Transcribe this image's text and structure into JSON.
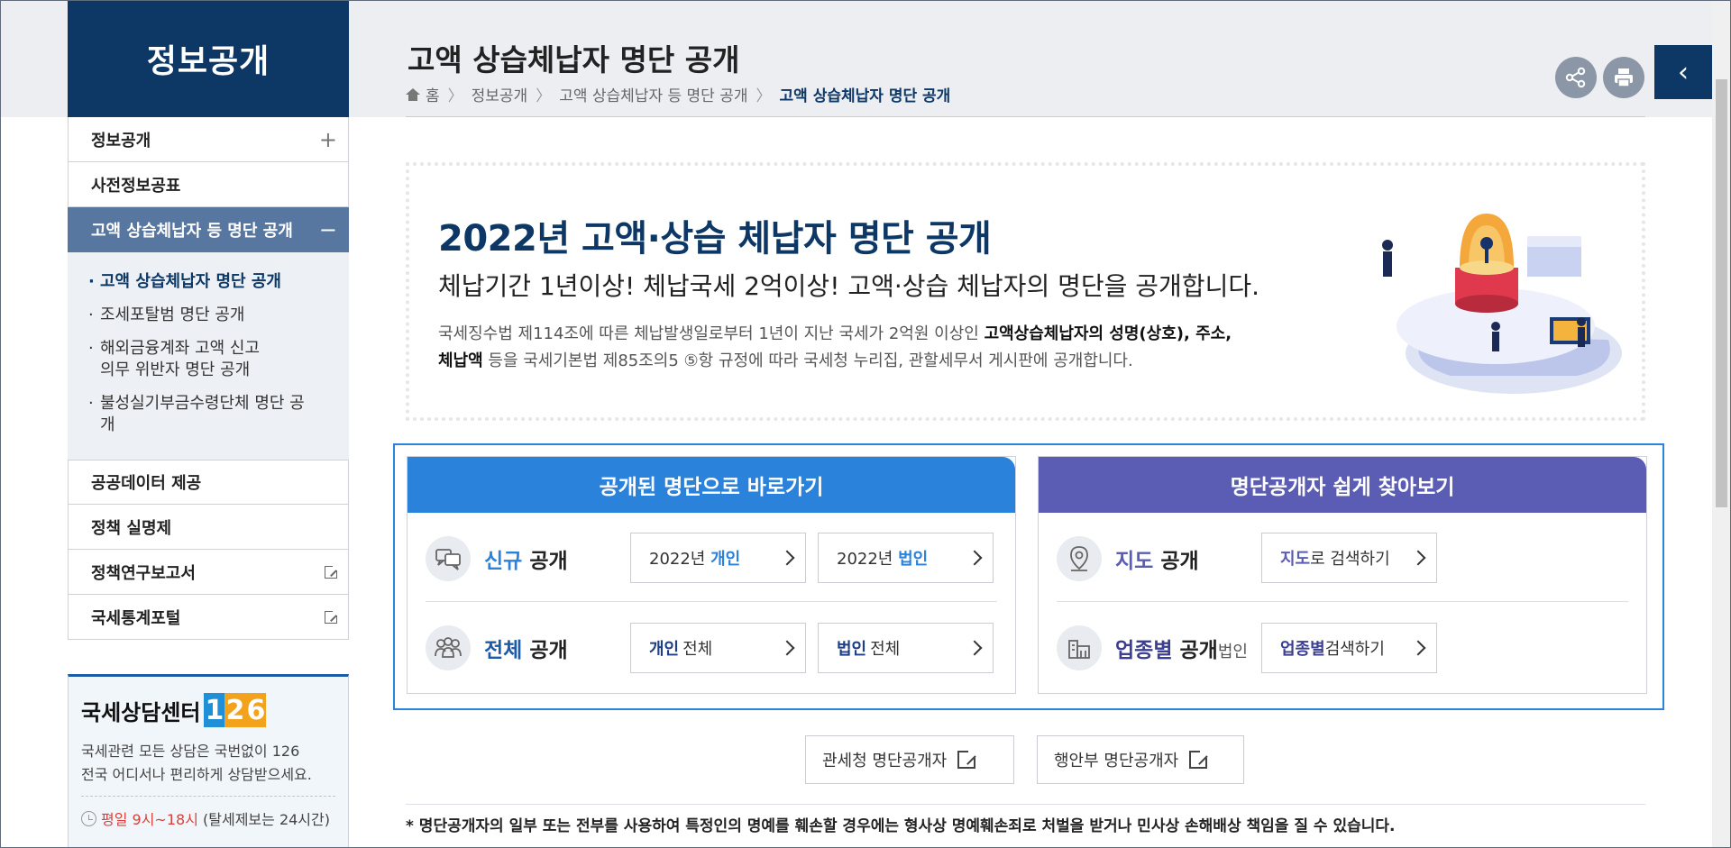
{
  "sidebar": {
    "title": "정보공개",
    "items": [
      {
        "label": "정보공개",
        "mark": "+"
      },
      {
        "label": "사전정보공표",
        "mark": ""
      },
      {
        "label": "고액 상습체납자 등 명단 공개",
        "mark": "−"
      }
    ],
    "sub_items": [
      {
        "label": "고액 상습체납자 명단 공개"
      },
      {
        "label": "조세포탈범 명단 공개"
      },
      {
        "label": "해외금융계좌 고액 신고 의무 위반자 명단 공개"
      },
      {
        "label": "불성실기부금수령단체 명단 공개"
      }
    ],
    "items_after": [
      {
        "label": "공공데이터 제공"
      },
      {
        "label": "정책 실명제"
      },
      {
        "label": "정책연구보고서"
      },
      {
        "label": "국세통계포털"
      }
    ]
  },
  "counsel": {
    "title": "국세상담센터",
    "digits": [
      "1",
      "2",
      "6"
    ],
    "digit_colors": [
      "#1f8fd8",
      "#f2a21b",
      "#f2a21b"
    ],
    "desc1": "국세관련 모든 상담은 국번없이 126",
    "desc2": "전국 어디서나 편리하게 상담받으세요.",
    "hours": "평일 9시~18시",
    "hours_note": "(탈세제보는 24시간)"
  },
  "header": {
    "title": "고액 상습체납자 명단 공개",
    "breadcrumb": [
      "홈",
      "정보공개",
      "고액 상습체납자 등 명단 공개",
      "고액 상습체납자 명단 공개"
    ]
  },
  "banner": {
    "title": "2022년 고액·상습 체납자 명단 공개",
    "subtitle": "체납기간 1년이상! 체납국세 2억이상! 고액·상습 체납자의 명단을 공개합니다.",
    "desc_a": "국세징수법 제114조에 따른 체납발생일로부터 1년이 지난 국세가 2억원 이상인 ",
    "desc_b": "고액상습체납자의 성명(상호), 주소,",
    "desc_c": "체납액",
    "desc_d": " 등을 국세기본법 제85조의5 ⑤항 규정에 따라 국세청 누리집, 관할세무서 게시판에 공개합니다."
  },
  "panel_left": {
    "title": "공개된 명단으로 바로가기",
    "color": "#2a82db",
    "row1": {
      "hl": "신규",
      "label": " 공개"
    },
    "row2": {
      "hl": "전체",
      "label": " 공개"
    },
    "btn_2022_personal_pre": "2022년",
    "btn_2022_personal_kw": "개인",
    "btn_2022_corp_pre": "2022년",
    "btn_2022_corp_kw": "법인",
    "btn_all_personal_kw": "개인",
    "btn_all_personal_post": "전체",
    "btn_all_corp_kw": "법인",
    "btn_all_corp_post": "전체"
  },
  "panel_right": {
    "title": "명단공개자 쉽게 찾아보기",
    "color": "#5b5cb3",
    "row1": {
      "hl": "지도",
      "label": " 공개"
    },
    "row2": {
      "hl": "업종별",
      "label": " 공개",
      "small": "법인"
    },
    "btn_map_kw": "지도",
    "btn_map_post": "로 검색하기",
    "btn_industry_kw": "업종별",
    "btn_industry_post": " 검색하기"
  },
  "external": {
    "customs": "관세청 명단공개자",
    "mois": "행안부 명단공개자"
  },
  "notice": "* 명단공개자의 일부 또는 전부를 사용하여 특정인의 명예를 훼손할 경우에는 형사상 명예훼손죄로 처벌을 받거나 민사상 손해배상 책임을 질 수 있습니다."
}
